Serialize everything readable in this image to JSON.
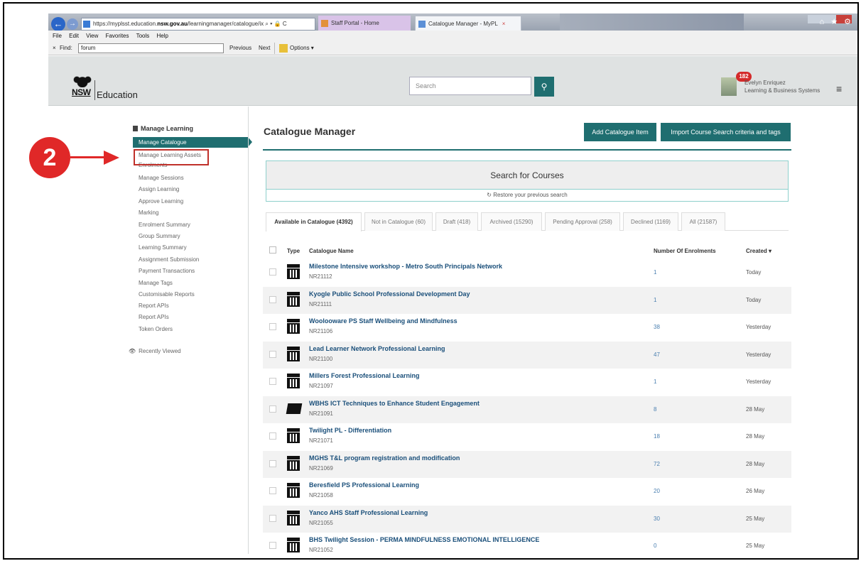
{
  "browser": {
    "url_prefix": "https://",
    "url_host": "myplsst.education.",
    "url_domain": "nsw.gov.au",
    "url_path": "/learningmanager/catalogue/ix",
    "url_tail": "⌕ ▾ 🔒 C",
    "tabs": [
      {
        "label": "Staff Portal - Home"
      },
      {
        "label": "Catalogue Manager - MyPL",
        "close": "×"
      }
    ],
    "menu": [
      "File",
      "Edit",
      "View",
      "Favorites",
      "Tools",
      "Help"
    ],
    "find_close": "×",
    "find_label": "Find:",
    "find_value": "forum",
    "find_prev": "Previous",
    "find_next": "Next",
    "find_options": "Options ▾",
    "toolbar_icons": "⌂ ★ ⚙"
  },
  "header": {
    "logo_text": "NSW",
    "brand": "Education",
    "search_placeholder": "Search",
    "search_icon": "search-icon",
    "notifications": "182",
    "user_name": "Evelyn Enriquez",
    "user_dept": "Learning & Business Systems",
    "menu_icon": "≡"
  },
  "sidebar": {
    "title": "Manage Learning",
    "active": "Manage Catalogue",
    "items": [
      "Manage Learning Assets",
      "Enrolments",
      "Manage Sessions",
      "Assign Learning",
      "Approve Learning",
      "Marking",
      "Enrolment Summary",
      "Group Summary",
      "Learning Summary",
      "Assignment Submission",
      "Payment Transactions",
      "Manage Tags",
      "Customisable Reports",
      "Report APIs",
      "Report APIs",
      "Token Orders"
    ],
    "recent": "Recently Viewed",
    "recent_icon": "👁"
  },
  "annotation": {
    "step": "2",
    "highlight_color": "#c0302a"
  },
  "main": {
    "title": "Catalogue Manager",
    "add_button": "Add Catalogue Item",
    "import_button": "Import Course Search criteria and tags",
    "search_title": "Search for Courses",
    "restore": "↻ Restore your previous search",
    "tabs": [
      "Available in Catalogue (4392)",
      "Not in Catalogue (60)",
      "Draft (418)",
      "Archived (15290)",
      "Pending Approval (258)",
      "Declined (1169)",
      "All (21587)"
    ],
    "columns": {
      "type": "Type",
      "name": "Catalogue Name",
      "enrolments": "Number Of Enrolments",
      "created": "Created ▾"
    },
    "rows": [
      {
        "name": "Milestone Intensive workshop - Metro South Principals Network",
        "code": "NR21112",
        "enrolments": "1",
        "created": "Today",
        "type": "calendar-icon"
      },
      {
        "name": "Kyogle Public School Professional Development Day",
        "code": "NR21111",
        "enrolments": "1",
        "created": "Today",
        "type": "calendar-icon"
      },
      {
        "name": "Woolooware PS Staff Wellbeing and Mindfulness",
        "code": "NR21106",
        "enrolments": "38",
        "created": "Yesterday",
        "type": "calendar-icon"
      },
      {
        "name": "Lead Learner Network Professional Learning",
        "code": "NR21100",
        "enrolments": "47",
        "created": "Yesterday",
        "type": "calendar-icon"
      },
      {
        "name": "Millers Forest Professional Learning",
        "code": "NR21097",
        "enrolments": "1",
        "created": "Yesterday",
        "type": "calendar-icon"
      },
      {
        "name": "WBHS ICT Techniques to Enhance Student Engagement",
        "code": "NR21091",
        "enrolments": "8",
        "created": "28 May",
        "type": "folder-icon"
      },
      {
        "name": "Twilight PL - Differentiation",
        "code": "NR21071",
        "enrolments": "18",
        "created": "28 May",
        "type": "calendar-icon"
      },
      {
        "name": "MGHS T&L program registration and modification",
        "code": "NR21069",
        "enrolments": "72",
        "created": "28 May",
        "type": "calendar-icon"
      },
      {
        "name": "Beresfield PS Professional Learning",
        "code": "NR21058",
        "enrolments": "20",
        "created": "26 May",
        "type": "calendar-icon"
      },
      {
        "name": "Yanco AHS Staff Professional Learning",
        "code": "NR21055",
        "enrolments": "30",
        "created": "25 May",
        "type": "calendar-icon"
      },
      {
        "name": "BHS Twilight Session - PERMA MINDFULNESS EMOTIONAL INTELLIGENCE",
        "code": "NR21052",
        "enrolments": "0",
        "created": "25 May",
        "type": "calendar-icon"
      }
    ]
  }
}
